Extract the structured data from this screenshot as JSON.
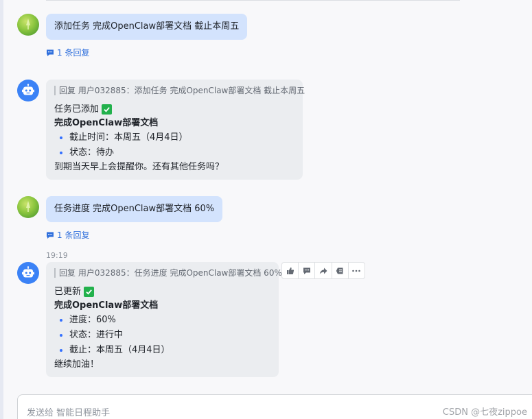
{
  "messages": [
    {
      "sender": "user",
      "text": "添加任务 完成OpenClaw部署文档 截止本周五",
      "reply_count": "1 条回复"
    },
    {
      "sender": "bot",
      "quote": "回复 用户032885：添加任务 完成OpenClaw部署文档 截止本周五",
      "heading": "任务已添加",
      "title": "完成OpenClaw部署文档",
      "items": [
        "截止时间：本周五（4月4日）",
        "状态：待办"
      ],
      "footer": "到期当天早上会提醒你。还有其他任务吗？"
    },
    {
      "sender": "user",
      "text": "任务进度 完成OpenClaw部署文档 60%",
      "reply_count": "1 条回复"
    },
    {
      "sender": "bot",
      "timestamp": "19:19",
      "quote": "回复 用户032885：任务进度 完成OpenClaw部署文档 60%",
      "heading": "已更新",
      "title": "完成OpenClaw部署文档",
      "items": [
        "进度：60%",
        "状态：进行中",
        "截止：本周五（4月4日）"
      ],
      "footer": "继续加油！"
    }
  ],
  "toolbar": {
    "icons": [
      "thumbs-up-icon",
      "comment-icon",
      "forward-icon",
      "pin-icon",
      "more-icon"
    ]
  },
  "input": {
    "placeholder": "发送给 智能日程助手"
  },
  "watermark": "CSDN @七夜zippoe",
  "colors": {
    "user_bubble": "#d3e3fd",
    "bot_bubble": "#ebedf0",
    "link": "#2f6fdc",
    "check": "#22b14c"
  }
}
